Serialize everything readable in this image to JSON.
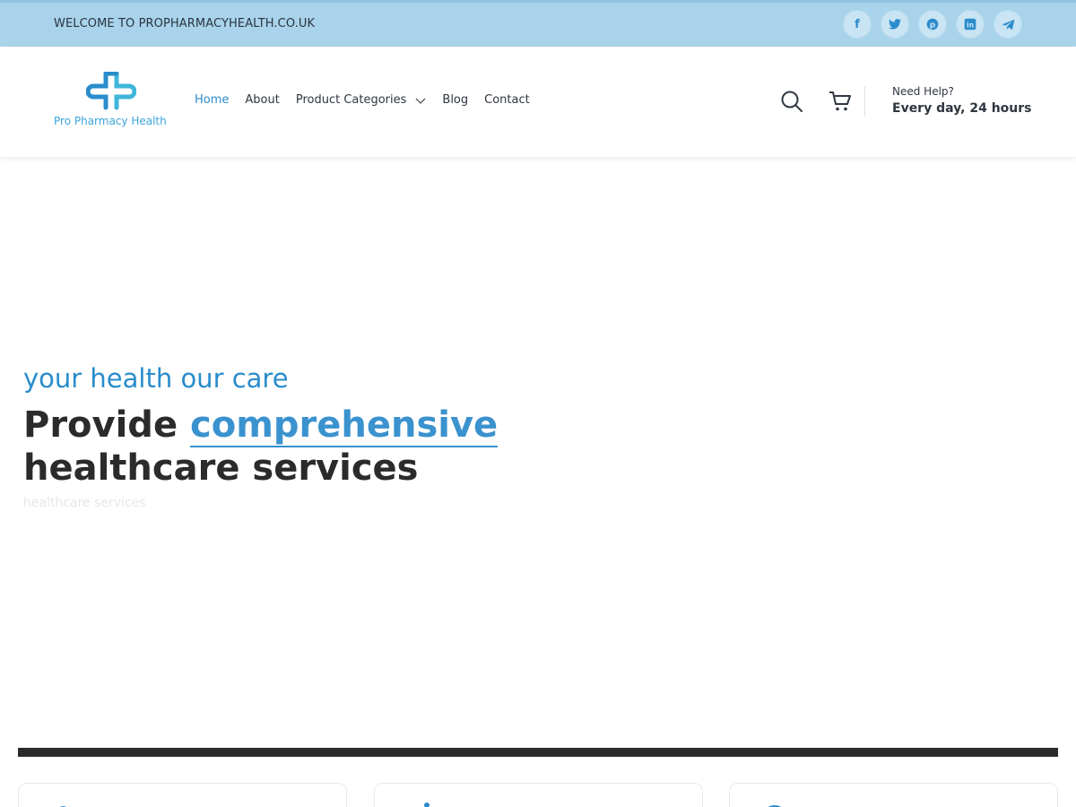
{
  "topbar": {
    "welcome": "WELCOME TO PROPHARMACYHEALTH.CO.UK",
    "socials": [
      "facebook-icon",
      "twitter-icon",
      "pinterest-icon",
      "linkedin-icon",
      "telegram-icon"
    ]
  },
  "header": {
    "logo_text": "Pro Pharmacy Health",
    "nav": {
      "home": "Home",
      "about": "About",
      "product_categories": "Product Categories",
      "blog": "Blog",
      "contact": "Contact"
    },
    "help_label": "Need Help?",
    "help_hours": "Every day, 24 hours"
  },
  "hero": {
    "kicker": "your health our care",
    "title_prefix": "Provide ",
    "title_accent": "comprehensive",
    "title_rest": "healthcare services",
    "ghost_text": "healthcare services"
  },
  "colors": {
    "accent": "#2a8ccc",
    "topbar_bg": "#a9d3ea",
    "dark": "#2b2b2b"
  }
}
